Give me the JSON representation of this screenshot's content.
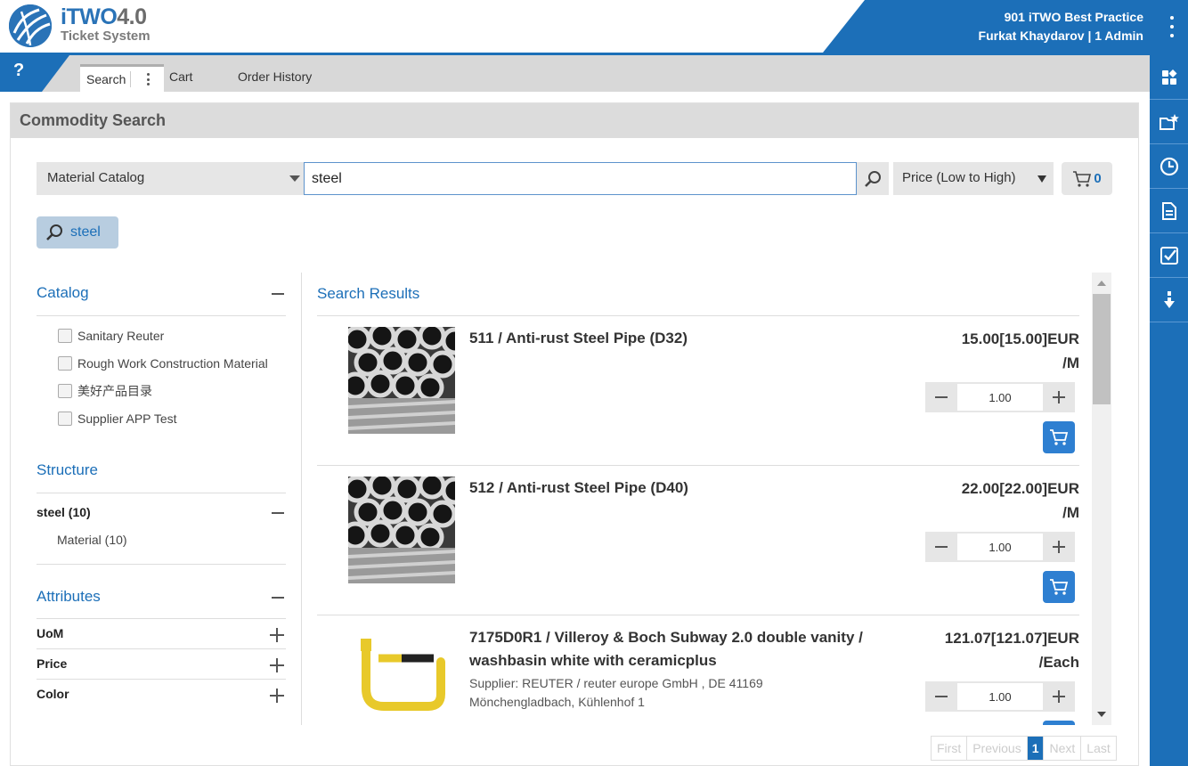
{
  "brand": {
    "name": "iTWO",
    "version": "4.0",
    "subtitle": "Ticket System"
  },
  "user": {
    "company": "901 iTWO Best Practice",
    "name_role": "Furkat Khaydarov | 1 Admin"
  },
  "help_label": "?",
  "tabs": [
    {
      "label": "Search",
      "active": true
    },
    {
      "label": "Cart",
      "active": false
    },
    {
      "label": "Order History",
      "active": false
    }
  ],
  "sidebar_icons": [
    "dashboard-icon",
    "favorites-icon",
    "history-icon",
    "document-icon",
    "checklist-icon",
    "download-icon"
  ],
  "panel_title": "Commodity Search",
  "search": {
    "catalog": "Material Catalog",
    "query": "steel",
    "sort": "Price (Low to High)",
    "cart_count": "0",
    "tag": "steel"
  },
  "filters": {
    "catalog_title": "Catalog",
    "catalog_items": [
      "Sanitary Reuter",
      "Rough Work Construction Material",
      "美好产品目录",
      "Supplier APP Test"
    ],
    "structure_title": "Structure",
    "structure_root": "steel (10)",
    "structure_child": "Material (10)",
    "attributes_title": "Attributes",
    "attributes": [
      "UoM",
      "Price",
      "Color"
    ]
  },
  "results": {
    "title": "Search Results",
    "items": [
      {
        "title": "511 / Anti-rust Steel Pipe (D32)",
        "price_line1": "15.00[15.00]EUR",
        "price_line2": "/M",
        "qty": "1.00",
        "supplier": "",
        "desc": ""
      },
      {
        "title": "512 / Anti-rust Steel Pipe (D40)",
        "price_line1": "22.00[22.00]EUR",
        "price_line2": "/M",
        "qty": "1.00",
        "supplier": "",
        "desc": ""
      },
      {
        "title": "7175D0R1 / Villeroy & Boch Subway 2.0 double vanity / washbasin white with ceramicplus",
        "price_line1": "121.07[121.07]EUR",
        "price_line2": "/Each",
        "qty": "1.00",
        "supplier": "Supplier: REUTER / reuter europe GmbH , DE 41169 Mönchengladbach, Kühlenhof 1",
        "desc": ""
      }
    ]
  },
  "pager": {
    "first": "First",
    "previous": "Previous",
    "current": "1",
    "next": "Next",
    "last": "Last"
  },
  "colors": {
    "brand_blue": "#1c6fb8",
    "button_blue": "#2e7fd1",
    "tag_bg": "#b8cde0"
  }
}
